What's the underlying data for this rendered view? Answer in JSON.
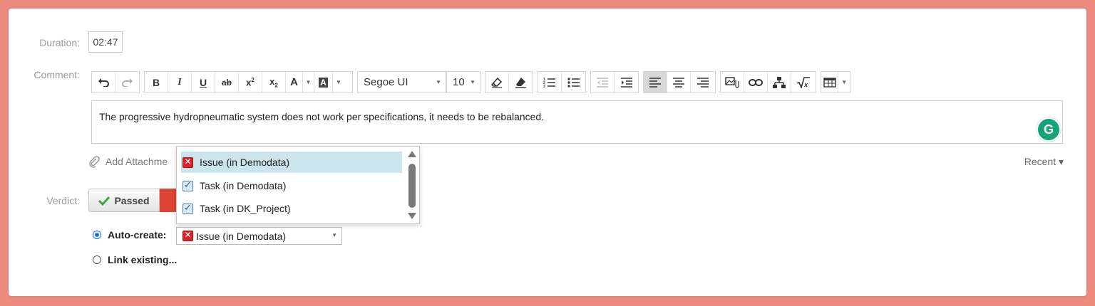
{
  "form": {
    "duration_label": "Duration:",
    "duration_value": "02:47",
    "comment_label": "Comment:",
    "verdict_label": "Verdict:"
  },
  "toolbar": {
    "font_name": "Segoe UI",
    "font_size": "10"
  },
  "editor": {
    "text": "The progressive hydropneumatic system does not work per specifications, it needs to be rebalanced."
  },
  "attachments": {
    "add_label": "Add Attachme",
    "recent_label": "Recent ▾"
  },
  "verdict": {
    "passed_label": "Passed"
  },
  "defect": {
    "auto_create_label": "Auto-create:",
    "link_existing_label": "Link existing...",
    "selected_type": "Issue (in Demodata)",
    "options": [
      {
        "label": "Issue (in Demodata)",
        "icon": "issue-icon"
      },
      {
        "label": "Task (in Demodata)",
        "icon": "task-icon"
      },
      {
        "label": "Task (in DK_Project)",
        "icon": "task-icon"
      }
    ]
  },
  "colors": {
    "background": "#ee8b80",
    "selected_option": "#cbe5ec",
    "fail": "#dd4433",
    "grammarly": "#15a37a"
  }
}
